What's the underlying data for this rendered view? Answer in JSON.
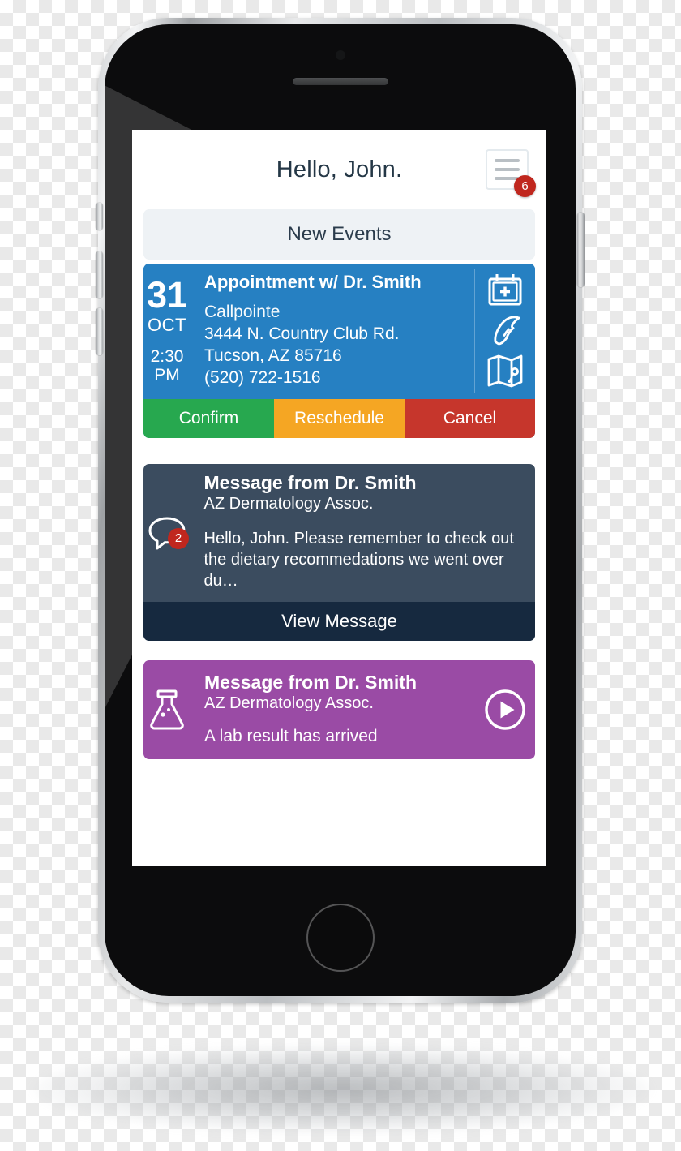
{
  "device": {
    "name": "smartphone-mockup",
    "hardware": {
      "earpiece": "earpiece-speaker",
      "home_button": "home-button",
      "buttons": [
        "silent-switch",
        "volume-up",
        "volume-down",
        "power-button"
      ]
    }
  },
  "header": {
    "title": "Hello, John.",
    "menu_icon": "hamburger-menu-icon",
    "menu_badge": "6"
  },
  "section": {
    "new_events_label": "New Events"
  },
  "appointment": {
    "day": "31",
    "month": "OCT",
    "time_line1": "2:30",
    "time_line2": "PM",
    "title": "Appointment w/ Dr. Smith",
    "place": "Callpointe",
    "street": "3444 N. Country Club Rd.",
    "city_state_zip": "Tucson, AZ 85716",
    "phone": "(520) 722-1516",
    "icons": [
      "calendar-plus-icon",
      "phone-icon",
      "map-pin-icon"
    ],
    "actions": {
      "confirm": "Confirm",
      "reschedule": "Reschedule",
      "cancel": "Cancel"
    },
    "colors": {
      "card": "#2680c2",
      "confirm": "#27a84f",
      "reschedule": "#f5a623",
      "cancel": "#c6362c"
    }
  },
  "message": {
    "icon": "speech-bubble-icon",
    "badge": "2",
    "title": "Message from Dr. Smith",
    "org": "AZ Dermatology Assoc.",
    "preview": "Hello, John.  Please remember to check out the dietary recommedations we went over du…",
    "view_label": "View Message",
    "colors": {
      "card": "#3b4c5f",
      "footer": "#16293f"
    }
  },
  "lab": {
    "icon": "flask-icon",
    "title": "Message from Dr. Smith",
    "org": "AZ Dermatology Assoc.",
    "text": "A lab result has arrived",
    "play_icon": "play-circle-icon",
    "colors": {
      "card": "#9a4ba5"
    }
  }
}
